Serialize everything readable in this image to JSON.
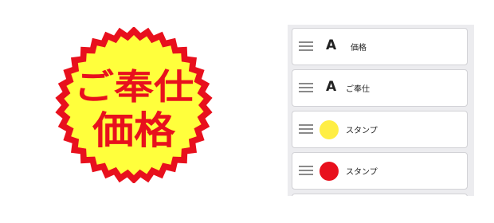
{
  "preview": {
    "sticker_line1": "ご奉仕",
    "sticker_line2": "価格",
    "text_color": "#e8101d",
    "fill_color": "#ffff3c",
    "outline_color": "#e8101d"
  },
  "layers": [
    {
      "type": "text",
      "icon_glyph": "A",
      "label": "価格"
    },
    {
      "type": "text",
      "icon_glyph": "A",
      "label": "ご奉仕"
    },
    {
      "type": "stamp",
      "swatch_color": "#ffee44",
      "label": "スタンプ"
    },
    {
      "type": "stamp",
      "swatch_color": "#e8101d",
      "label": "スタンプ"
    }
  ]
}
